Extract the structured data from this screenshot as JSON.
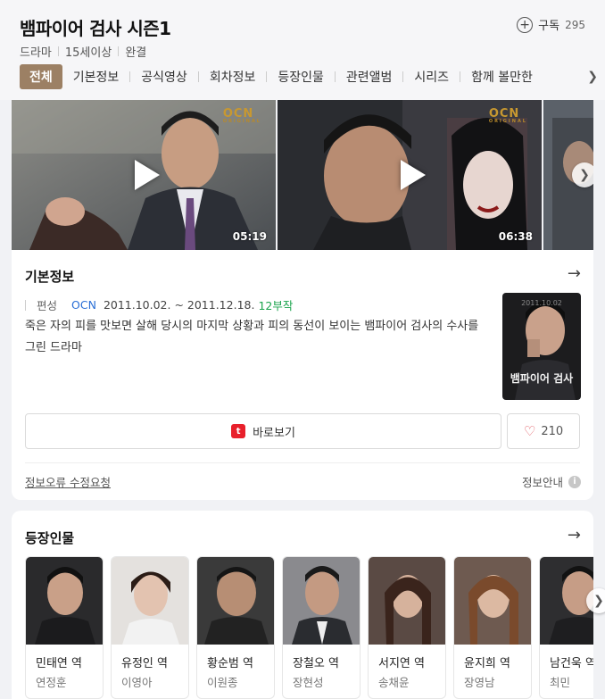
{
  "header": {
    "title": "뱀파이어 검사 시즌1",
    "subscribe_label": "구독",
    "subscribe_count": "295",
    "meta": [
      "드라마",
      "15세이상",
      "완결"
    ]
  },
  "tabs": [
    "전체",
    "기본정보",
    "공식영상",
    "회차정보",
    "등장인물",
    "관련앨범",
    "시리즈",
    "함께 볼만한"
  ],
  "videos": [
    {
      "duration": "05:19",
      "badge": "OCN",
      "badge_sub": "ORIGINAL"
    },
    {
      "duration": "06:38",
      "badge": "OCN",
      "badge_sub": "ORIGINAL"
    }
  ],
  "info": {
    "section_title": "기본정보",
    "broadcast_label": "편성",
    "channel": "OCN",
    "dates": "2011.10.02. ~ 2011.12.18.",
    "episodes": "12부작",
    "description": "죽은 자의 피를 맛보면 살해 당시의 마지막 상황과 피의 동선이 보이는 뱀파이어 검사의 수사를 그린 드라마",
    "poster_title": "뱀파이어 검사",
    "poster_date": "2011.10.02",
    "watch_label": "바로보기",
    "like_count": "210",
    "error_link": "정보오류 수정요청",
    "info_guide": "정보안내"
  },
  "cast": {
    "section_title": "등장인물",
    "people": [
      {
        "role": "민태연 역",
        "actor": "연정훈"
      },
      {
        "role": "유정인 역",
        "actor": "이영아"
      },
      {
        "role": "황순범 역",
        "actor": "이원종"
      },
      {
        "role": "장철오 역",
        "actor": "장현성"
      },
      {
        "role": "서지연 역",
        "actor": "송채윤"
      },
      {
        "role": "윤지희 역",
        "actor": "장영남"
      },
      {
        "role": "남건욱 역",
        "actor": "최민"
      }
    ]
  },
  "colors": {
    "active_tab": "#9c8064",
    "channel_link": "#2a6fd6",
    "episode_green": "#1ba34d",
    "tving_red": "#e8202b",
    "heart": "#e0535b"
  }
}
